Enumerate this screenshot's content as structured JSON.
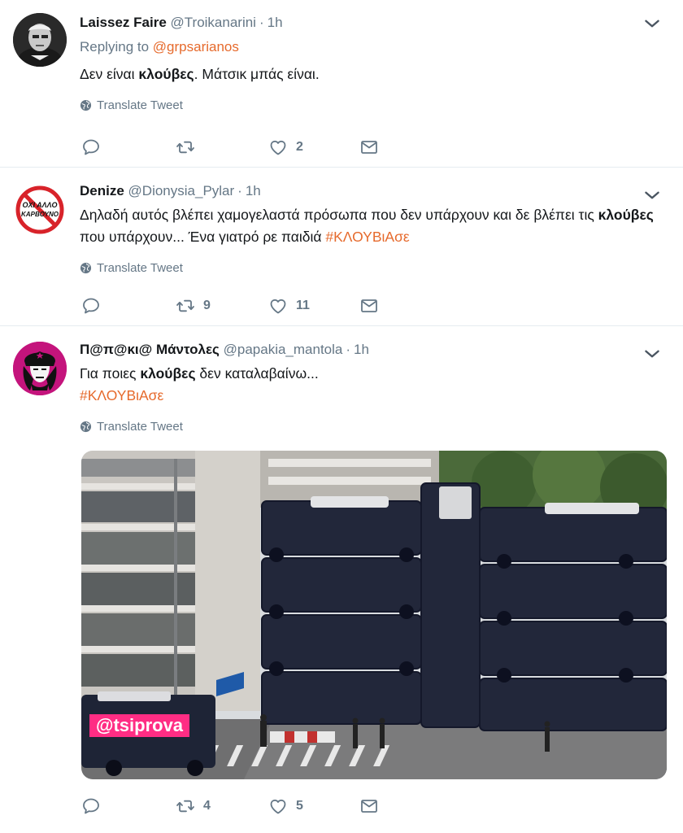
{
  "tweets": [
    {
      "name": "Laissez Faire",
      "handle": "@Troikanarini",
      "dot": "·",
      "time": "1h",
      "replying_prefix": "Replying to ",
      "replying_to": "@grpsarianos",
      "text_pre": "Δεν είναι ",
      "text_bold": "κλούβες",
      "text_post": ". Μάτσικ μπάς είναι.",
      "translate": "Translate Tweet",
      "replies": "",
      "retweets": "",
      "likes": "2"
    },
    {
      "name": "Denize",
      "handle": "@Dionysia_Pylar",
      "dot": "·",
      "time": "1h",
      "avatar_text_top": "ΟΧΙ ΑΛΛΟ",
      "avatar_text_bottom": "ΚΑΡΒΟΥΝΟ",
      "text_pre": "Δηλαδή αυτός βλέπει χαμογελαστά πρόσωπα που δεν υπάρχουν και δε βλέπει τις ",
      "text_bold": "κλούβες",
      "text_post": " που υπάρχουν... Ένα γιατρό ρε παιδιά ",
      "hashtag": "#ΚΛΟΥΒιΑσε",
      "translate": "Translate Tweet",
      "replies": "",
      "retweets": "9",
      "likes": "11"
    },
    {
      "name": "Π@π@κι@ Μάντολες",
      "handle": "@papakia_mantola",
      "dot": "·",
      "time": "1h",
      "text_pre": "Για ποιες ",
      "text_bold": "κλούβες",
      "text_post": " δεν καταλαβαίνω...",
      "hashtag": "#ΚΛΟΥΒιΑσε",
      "translate": "Translate Tweet",
      "media_watermark": "@tsiprova",
      "replies": "",
      "retweets": "4",
      "likes": "5"
    }
  ],
  "colors": {
    "link": "#e66a2c",
    "secondary": "#657786",
    "divider": "#e6ecf0"
  },
  "icons": [
    "reply-icon",
    "retweet-icon",
    "like-icon",
    "message-icon",
    "globe-icon",
    "chevron-down-icon"
  ]
}
